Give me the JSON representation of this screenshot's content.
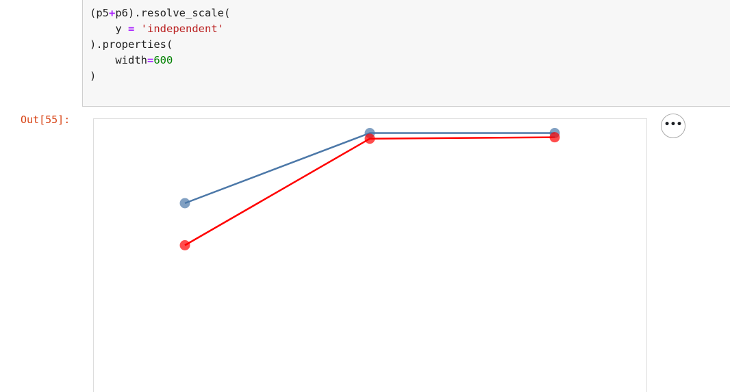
{
  "code_cell": {
    "lines": [
      [
        {
          "t": "(p5",
          "c": ""
        },
        {
          "t": "+",
          "c": "op"
        },
        {
          "t": "p6).resolve_scale(",
          "c": ""
        }
      ],
      [
        {
          "t": "    y ",
          "c": ""
        },
        {
          "t": "=",
          "c": "op"
        },
        {
          "t": " ",
          "c": ""
        },
        {
          "t": "'independent'",
          "c": "str"
        }
      ],
      [
        {
          "t": ").properties(",
          "c": ""
        }
      ],
      [
        {
          "t": "    width",
          "c": ""
        },
        {
          "t": "=",
          "c": "op"
        },
        {
          "t": "600",
          "c": "num"
        }
      ],
      [
        {
          "t": ")",
          "c": ""
        }
      ]
    ]
  },
  "output": {
    "prompt": "Out[55]:",
    "actions_label": "•••"
  },
  "chart_data": {
    "type": "line",
    "x": [
      0,
      1,
      2
    ],
    "series": [
      {
        "color": "#4c78a8",
        "values": [
          0.7,
          0.95,
          0.95
        ]
      },
      {
        "color": "#ff0000",
        "values": [
          0.55,
          0.93,
          0.935
        ]
      }
    ],
    "ylim": [
      0,
      1
    ],
    "point_marks": true
  }
}
